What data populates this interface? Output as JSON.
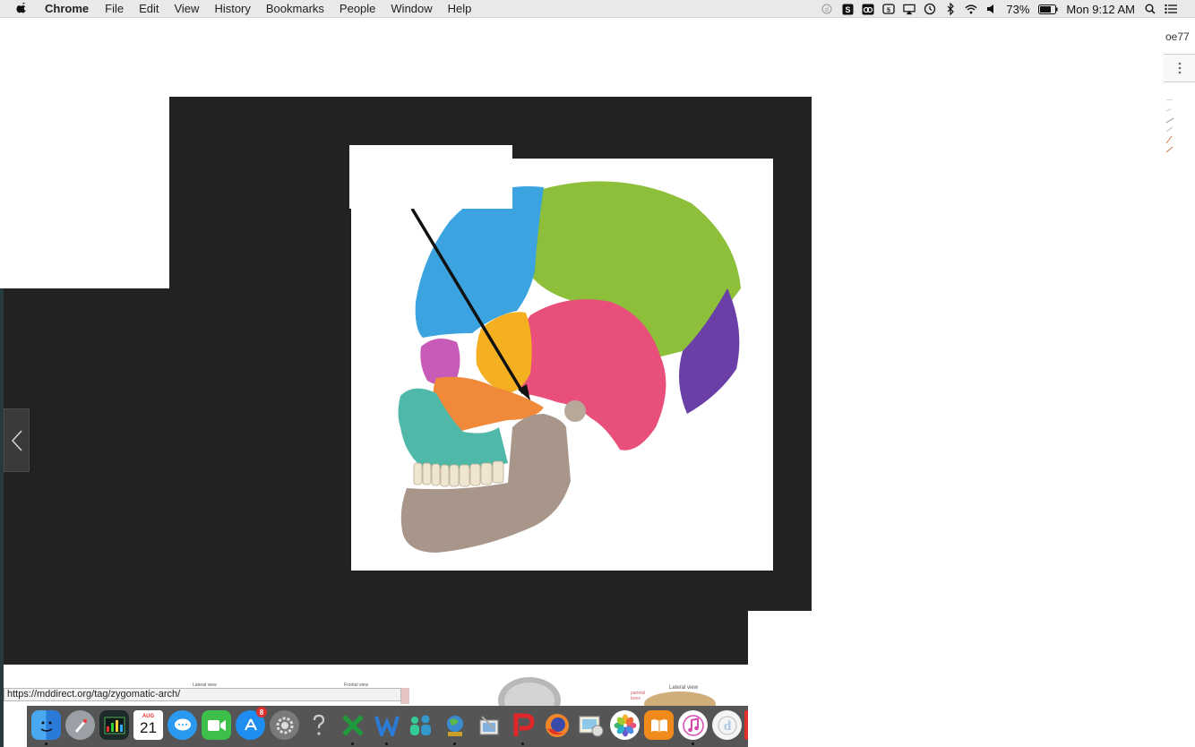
{
  "menubar": {
    "app_name": "Chrome",
    "menus": [
      "File",
      "Edit",
      "View",
      "History",
      "Bookmarks",
      "People",
      "Window",
      "Help"
    ],
    "status": {
      "battery_percent": "73%",
      "clock": "Mon 9:12 AM"
    }
  },
  "browser": {
    "tab_fragment": "oe77",
    "status_url": "https://mddirect.org/tag/zygomatic-arch/"
  },
  "thumbnails": {
    "labels": [
      "Lateral view",
      "Frontal view",
      "Lateral view"
    ],
    "small_labels": [
      "parietal",
      "bone"
    ]
  },
  "dock": {
    "calendar_month": "AUG",
    "calendar_day": "21",
    "app_store_badge": "8",
    "items": [
      "Finder",
      "Launchpad",
      "Activity Monitor",
      "Calendar",
      "Messages",
      "FaceTime",
      "App Store",
      "System Preferences",
      "Help",
      "Excel",
      "Word",
      "Family",
      "Network",
      "Preview",
      "PDF Expert",
      "Firefox",
      "Photo Viewer",
      "Photos",
      "iBooks",
      "iTunes",
      "Dictionary"
    ]
  },
  "colors": {
    "lightbox_bg": "#222222",
    "skull_frontal": "#3aa3e0",
    "skull_parietal": "#8dbf3a",
    "skull_occipital": "#6a3fa8",
    "skull_temporal": "#e84f7a",
    "skull_sphenoid": "#f5b021",
    "skull_zygomatic": "#f08a3a",
    "skull_maxilla": "#4fb8a8",
    "skull_mandible": "#a8968a"
  }
}
